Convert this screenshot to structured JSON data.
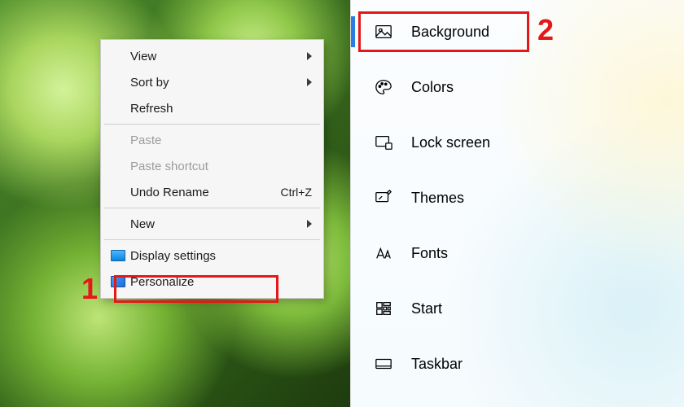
{
  "context_menu": {
    "view": "View",
    "sort_by": "Sort by",
    "refresh": "Refresh",
    "paste": "Paste",
    "paste_shortcut": "Paste shortcut",
    "undo_rename": "Undo Rename",
    "undo_rename_key": "Ctrl+Z",
    "new": "New",
    "display_settings": "Display settings",
    "personalize": "Personalize"
  },
  "settings_nav": {
    "background": "Background",
    "colors": "Colors",
    "lock_screen": "Lock screen",
    "themes": "Themes",
    "fonts": "Fonts",
    "start": "Start",
    "taskbar": "Taskbar"
  },
  "annotations": {
    "step1": "1",
    "step2": "2"
  }
}
